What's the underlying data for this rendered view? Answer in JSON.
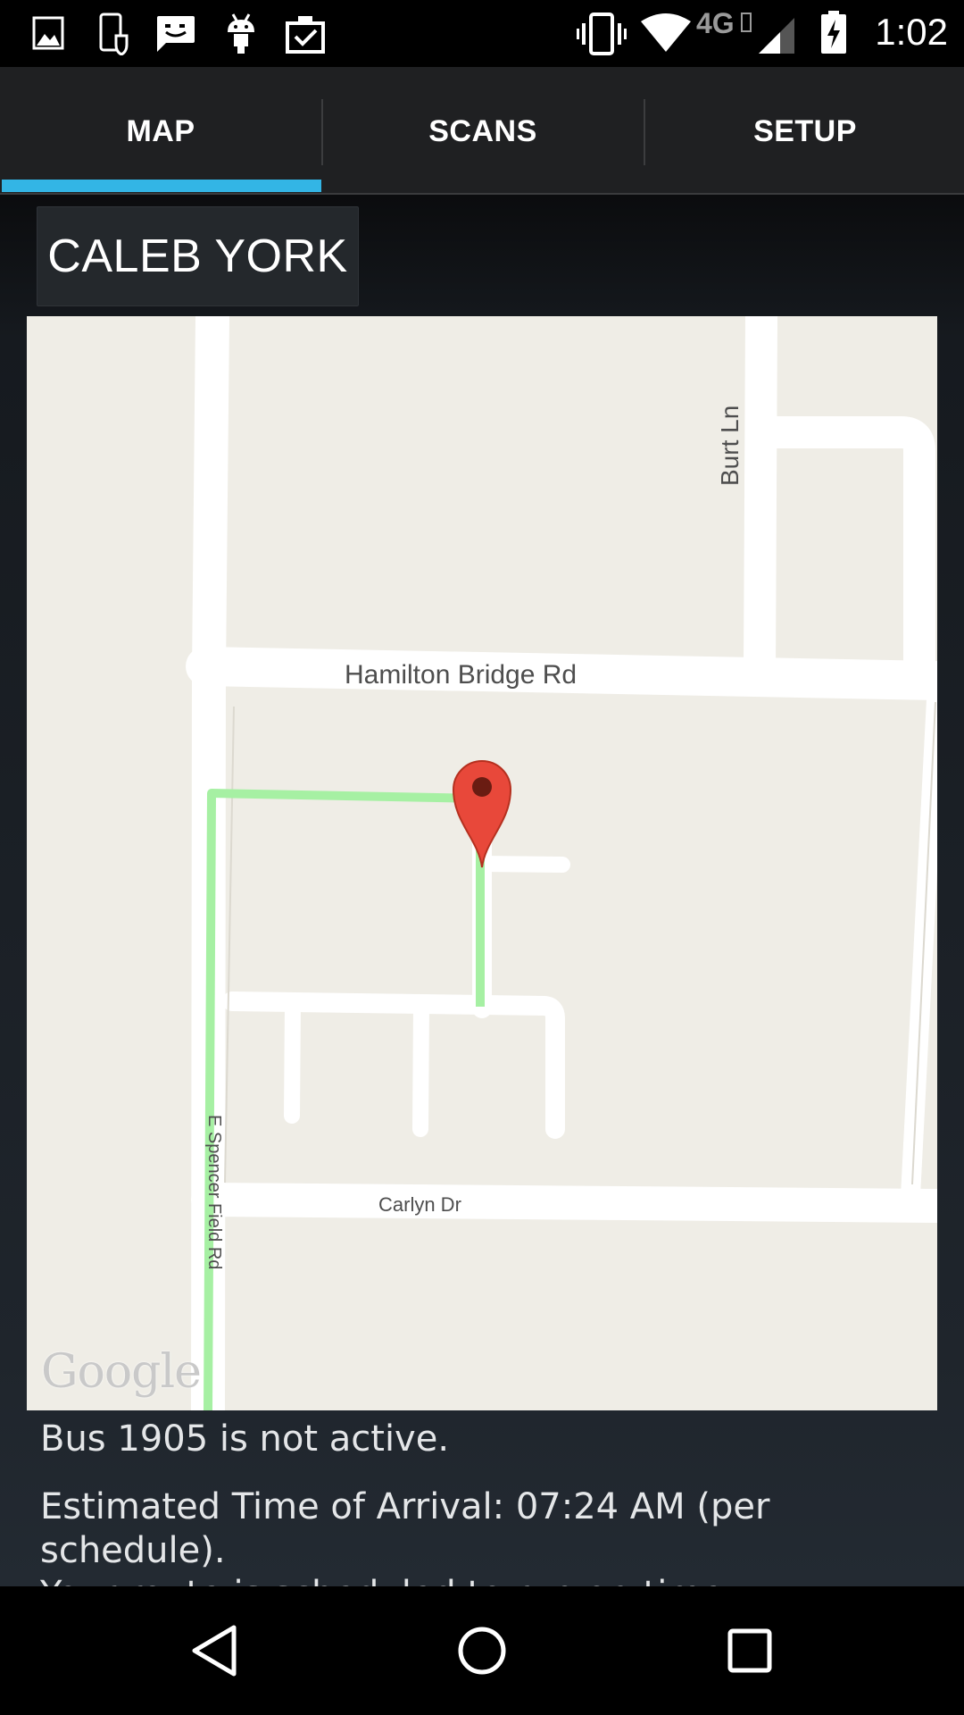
{
  "status_bar": {
    "time": "1:02",
    "network_label": "4G",
    "left_icons": [
      "image-icon",
      "phone-shield-icon",
      "message-icon",
      "android-icon",
      "clipboard-check-icon"
    ],
    "right_icons": [
      "vibrate-icon",
      "wifi-icon",
      "lte-icon",
      "signal-icon",
      "battery-charging-icon"
    ]
  },
  "tabs": [
    {
      "label": "MAP",
      "selected": true
    },
    {
      "label": "SCANS",
      "selected": false
    },
    {
      "label": "SETUP",
      "selected": false
    }
  ],
  "accent_color": "#33b5e5",
  "student": {
    "name": "CALEB YORK"
  },
  "map": {
    "streets": {
      "hamilton": "Hamilton Bridge Rd",
      "burt": "Burt Ln",
      "carlyn": "Carlyn Dr",
      "spencer": "E Spencer Field Rd"
    },
    "attribution": "Google",
    "route_color": "#a6f0a3",
    "marker_color": "#e8483a"
  },
  "info": {
    "bus_status": "Bus 1905 is not active.",
    "eta_line1": "Estimated Time of Arrival: 07:24 AM (per schedule).",
    "eta_line2": "Your route is scheduled to run on-time."
  },
  "nav": [
    "back-icon",
    "home-icon",
    "recents-icon"
  ]
}
